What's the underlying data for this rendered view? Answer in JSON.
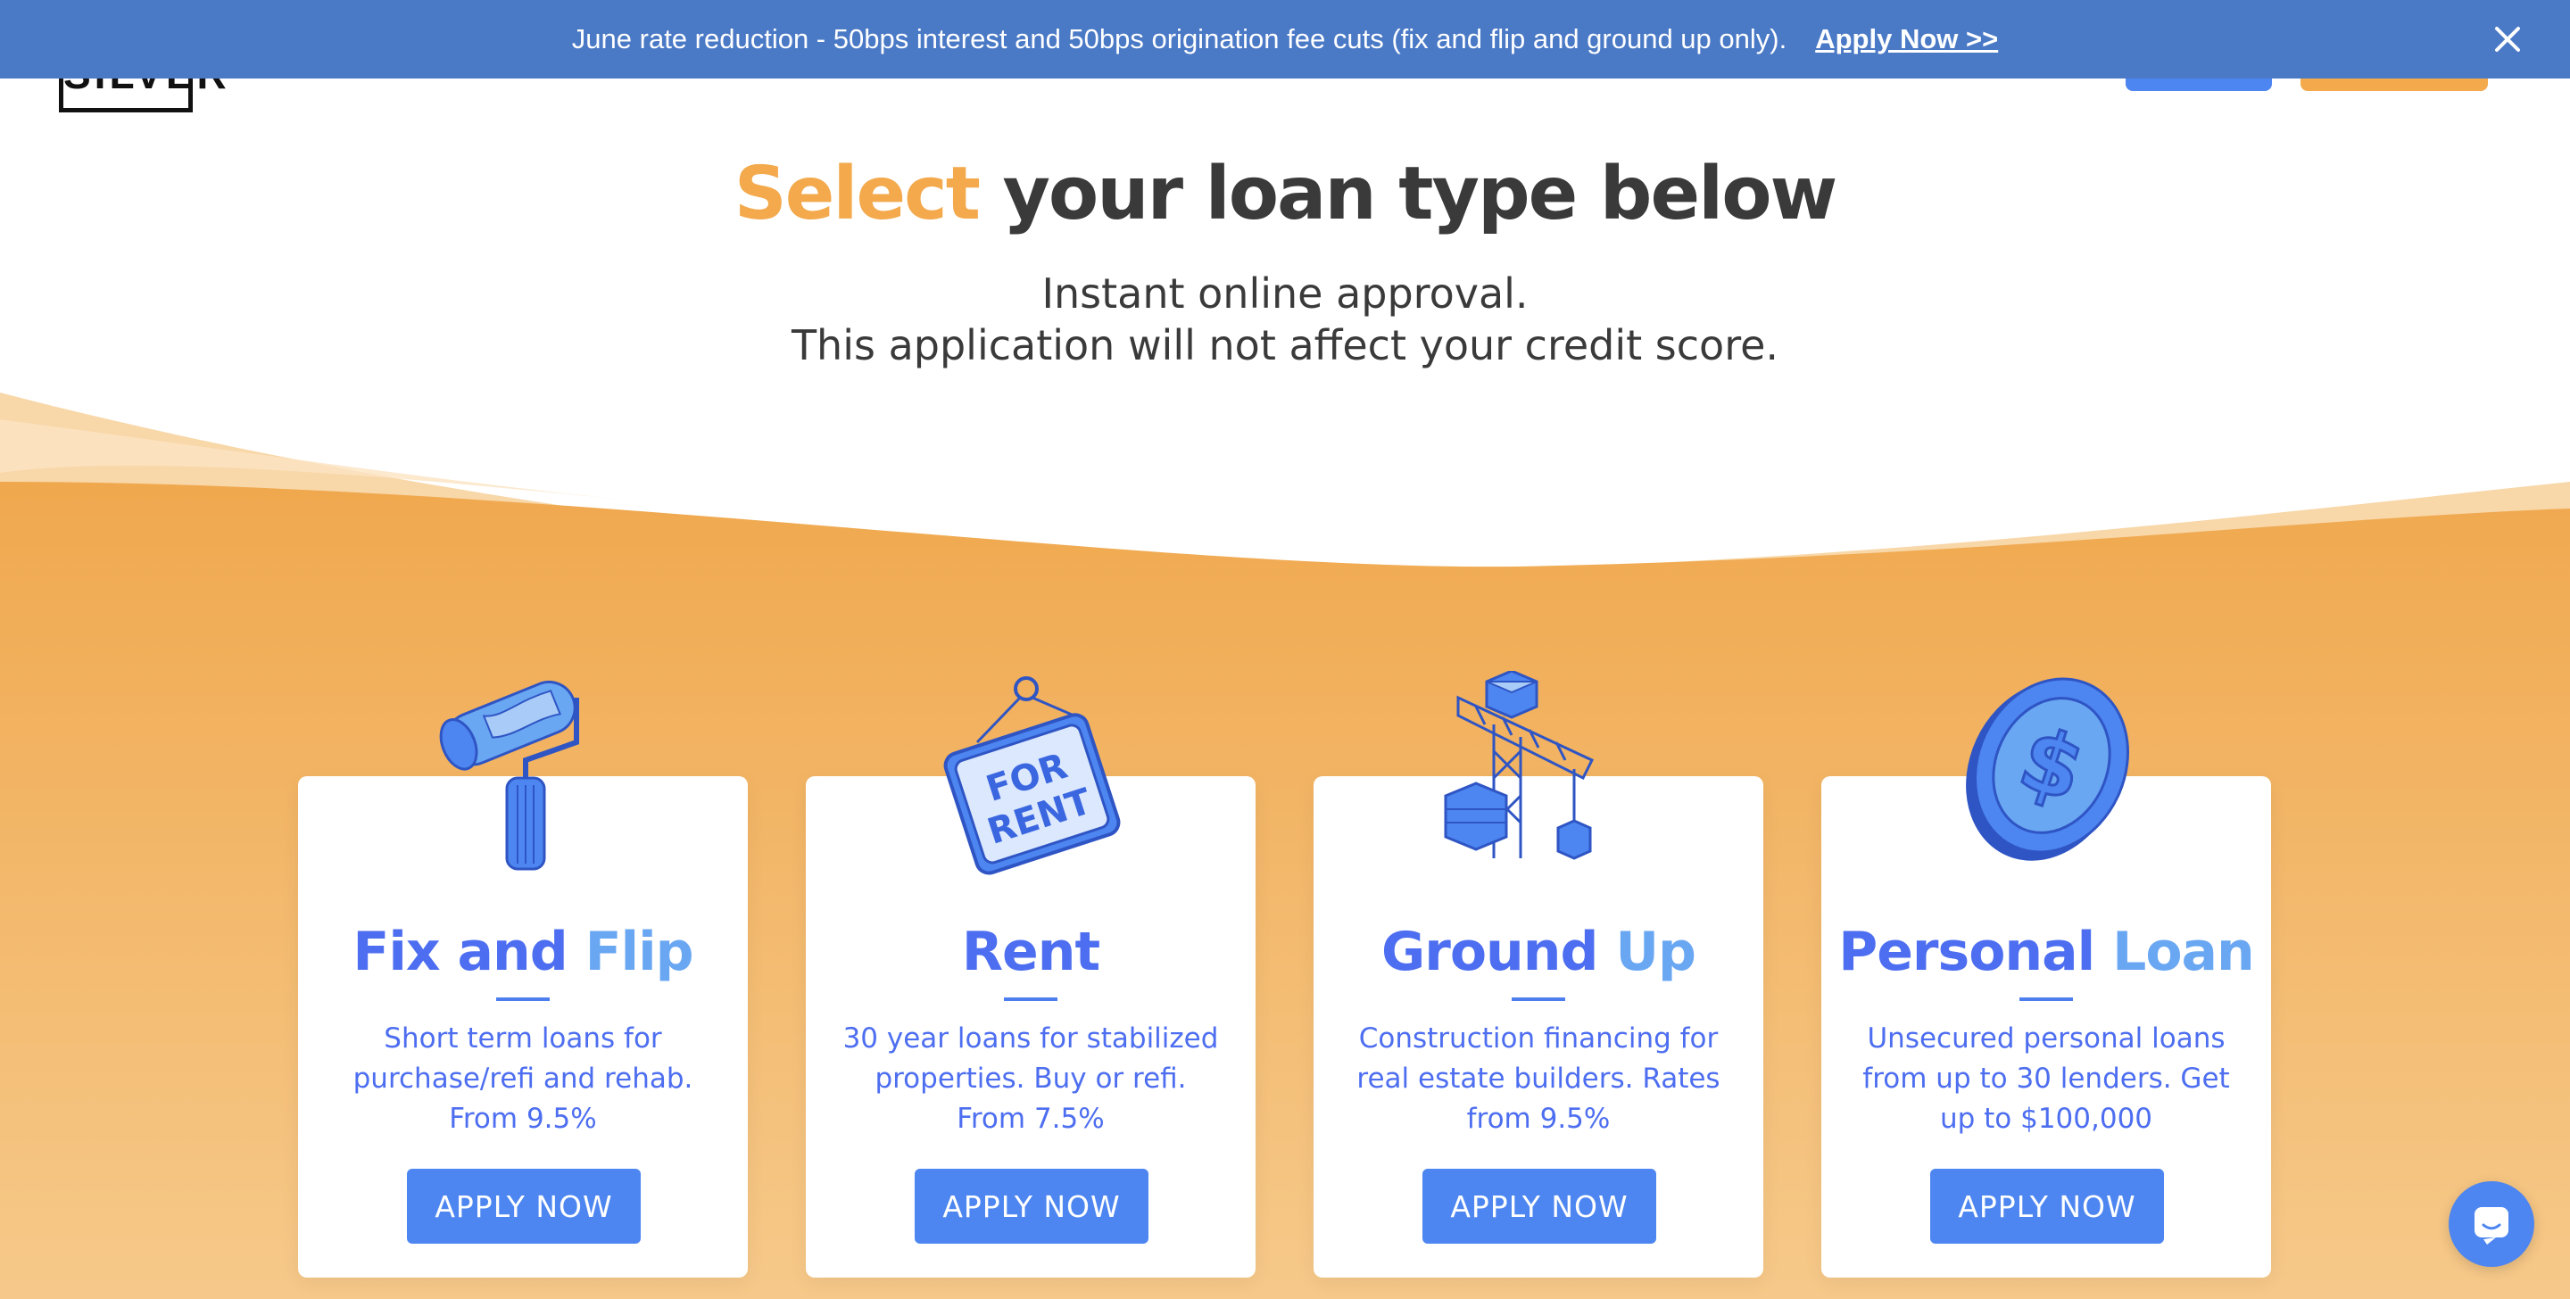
{
  "banner": {
    "message": "June rate reduction - 50bps interest and 50bps origination fee cuts (fix and flip and ground up only).",
    "link_label": "Apply Now >>",
    "close_icon": "close-icon"
  },
  "header": {
    "logo_text": "SILVER"
  },
  "hero": {
    "title_accent": "Select",
    "title_rest": " your loan type below",
    "subtitle_line1": "Instant online approval.",
    "subtitle_line2": "This application will not affect your credit score."
  },
  "cards": [
    {
      "icon": "paint-roller-icon",
      "title_a": "Fix ",
      "title_b": "and ",
      "title_c": "Flip",
      "description": "Short term loans for purchase/refi and rehab. From 9.5%",
      "button_label": "APPLY NOW"
    },
    {
      "icon": "for-rent-sign-icon",
      "title_a": "Rent",
      "title_b": "",
      "title_c": "",
      "description": "30 year loans for stabilized properties. Buy or refi. From 7.5%",
      "button_label": "APPLY NOW",
      "sign_line1": "FOR",
      "sign_line2": "RENT"
    },
    {
      "icon": "construction-crane-icon",
      "title_a": "Ground ",
      "title_b": "",
      "title_c": "Up",
      "description": "Construction financing for real estate builders. Rates from 9.5%",
      "button_label": "APPLY NOW"
    },
    {
      "icon": "dollar-coin-icon",
      "title_a": "Personal ",
      "title_b": "",
      "title_c": "Loan",
      "description": "Unsecured personal loans from up to 30 lenders. Get up to $100,000",
      "button_label": "APPLY NOW"
    }
  ],
  "chat": {
    "icon": "chat-icon"
  },
  "colors": {
    "banner": "#4a79c6",
    "accent_orange": "#f3a94c",
    "primary_blue": "#4d86f0",
    "title_blue": "#4d6ef0",
    "title_light_blue": "#6aa7f2",
    "heading_gray": "#3a3a3a"
  }
}
